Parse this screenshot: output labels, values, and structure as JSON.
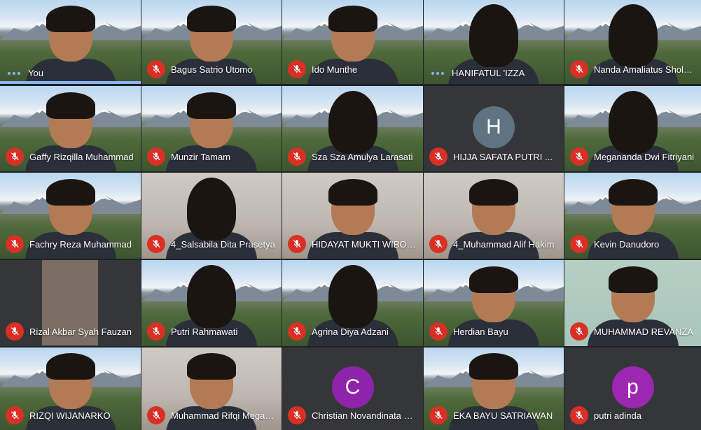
{
  "participants": [
    {
      "name": "You",
      "mic": "active",
      "avatar_letter": "",
      "avatar_color": ""
    },
    {
      "name": "Bagus Satrio Utomo",
      "mic": "muted",
      "avatar_letter": "",
      "avatar_color": ""
    },
    {
      "name": "Ido Munthe",
      "mic": "muted",
      "avatar_letter": "",
      "avatar_color": ""
    },
    {
      "name": "HANIFATUL 'IZZA",
      "mic": "active",
      "avatar_letter": "",
      "avatar_color": ""
    },
    {
      "name": "Nanda Amaliatus Sholehah",
      "mic": "muted",
      "avatar_letter": "",
      "avatar_color": ""
    },
    {
      "name": "Gaffy Rizqilla Muhammad",
      "mic": "muted",
      "avatar_letter": "",
      "avatar_color": ""
    },
    {
      "name": "Munzir Tamam",
      "mic": "muted",
      "avatar_letter": "",
      "avatar_color": ""
    },
    {
      "name": "Sza Sza Amulya Larasati",
      "mic": "muted",
      "avatar_letter": "",
      "avatar_color": ""
    },
    {
      "name": "HIJJA SAFATA PUTRI ...",
      "mic": "muted",
      "avatar_letter": "H",
      "avatar_color": "#5f7480"
    },
    {
      "name": "Megananda Dwi Fitriyani",
      "mic": "muted",
      "avatar_letter": "",
      "avatar_color": ""
    },
    {
      "name": "Fachry Reza Muhammad",
      "mic": "muted",
      "avatar_letter": "",
      "avatar_color": ""
    },
    {
      "name": "4_Salsabila Dita Prasetya",
      "mic": "muted",
      "avatar_letter": "",
      "avatar_color": ""
    },
    {
      "name": "HIDAYAT MUKTI WIBOWO",
      "mic": "muted",
      "avatar_letter": "",
      "avatar_color": ""
    },
    {
      "name": "4_Muhammad Alif Hakim",
      "mic": "muted",
      "avatar_letter": "",
      "avatar_color": ""
    },
    {
      "name": "Kevin Danudoro",
      "mic": "muted",
      "avatar_letter": "",
      "avatar_color": ""
    },
    {
      "name": "Rizal Akbar Syah Fauzan",
      "mic": "muted",
      "avatar_letter": "",
      "avatar_color": ""
    },
    {
      "name": "Putri Rahmawati",
      "mic": "muted",
      "avatar_letter": "",
      "avatar_color": ""
    },
    {
      "name": "Agrina Diya Adzani",
      "mic": "muted",
      "avatar_letter": "",
      "avatar_color": ""
    },
    {
      "name": "Herdian Bayu",
      "mic": "muted",
      "avatar_letter": "",
      "avatar_color": ""
    },
    {
      "name": "MUHAMMAD REVANZA",
      "mic": "muted",
      "avatar_letter": "",
      "avatar_color": ""
    },
    {
      "name": "RIZQI WIJANARKO",
      "mic": "muted",
      "avatar_letter": "",
      "avatar_color": ""
    },
    {
      "name": "Muhammad Rifqi Megantara",
      "mic": "muted",
      "avatar_letter": "",
      "avatar_color": ""
    },
    {
      "name": "Christian Novandinata Putra",
      "mic": "muted",
      "avatar_letter": "C",
      "avatar_color": "#8e24aa"
    },
    {
      "name": "EKA BAYU SATRIAWAN",
      "mic": "muted",
      "avatar_letter": "",
      "avatar_color": ""
    },
    {
      "name": "putri adinda",
      "mic": "muted",
      "avatar_letter": "p",
      "avatar_color": "#9c27b0"
    }
  ],
  "colors": {
    "background": "#202124",
    "muted_red": "#d93025",
    "active_blue": "#8ab4f8"
  }
}
